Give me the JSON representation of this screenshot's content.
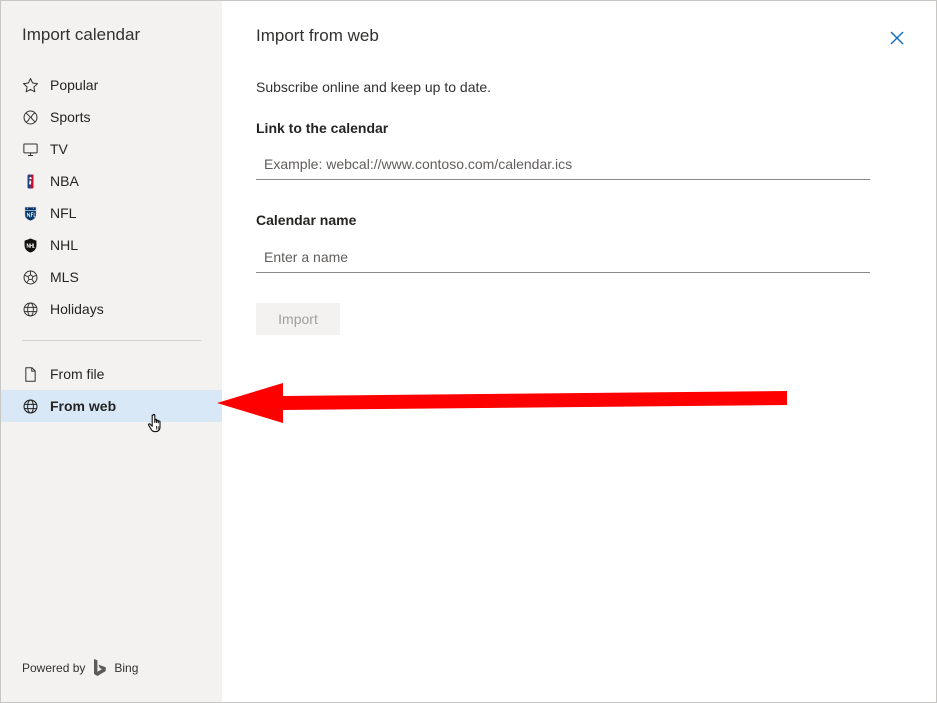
{
  "sidebar": {
    "title": "Import calendar",
    "items": [
      {
        "label": "Popular",
        "icon": "star-icon"
      },
      {
        "label": "Sports",
        "icon": "sports-ball-icon"
      },
      {
        "label": "TV",
        "icon": "tv-icon"
      },
      {
        "label": "NBA",
        "icon": "nba-logo-icon"
      },
      {
        "label": "NFL",
        "icon": "nfl-logo-icon"
      },
      {
        "label": "NHL",
        "icon": "nhl-logo-icon"
      },
      {
        "label": "MLS",
        "icon": "soccer-ball-icon"
      },
      {
        "label": "Holidays",
        "icon": "globe-icon"
      }
    ],
    "sources": [
      {
        "label": "From file",
        "icon": "file-icon",
        "selected": false
      },
      {
        "label": "From web",
        "icon": "globe-icon",
        "selected": true
      }
    ],
    "powered_by": "Powered by",
    "bing_label": "Bing"
  },
  "main": {
    "title": "Import from web",
    "subtitle": "Subscribe online and keep up to date.",
    "link_label": "Link to the calendar",
    "link_placeholder": "Example: webcal://www.contoso.com/calendar.ics",
    "link_value": "",
    "name_label": "Calendar name",
    "name_placeholder": "Enter a name",
    "name_value": "",
    "import_label": "Import",
    "import_enabled": false
  },
  "colors": {
    "sidebar_bg": "#f3f2f1",
    "selected_bg": "#d9e8f6",
    "accent": "#0f6cbd",
    "annotation_arrow": "#ff0000",
    "disabled_text": "#a19f9d"
  }
}
